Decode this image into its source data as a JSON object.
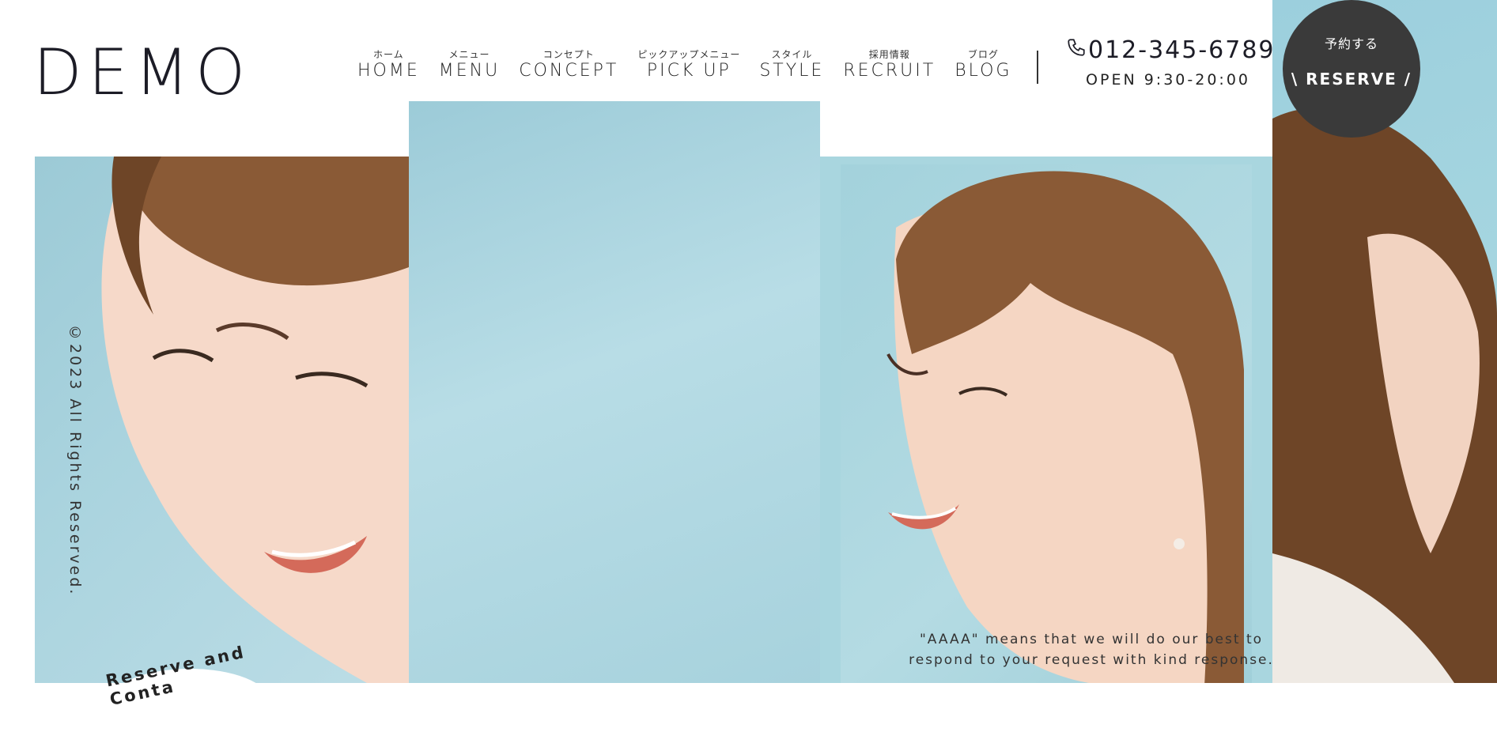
{
  "header": {
    "logo": "DEMO",
    "nav": [
      {
        "jp": "ホーム",
        "en": "HOME"
      },
      {
        "jp": "メニュー",
        "en": "MENU"
      },
      {
        "jp": "コンセプト",
        "en": "CONCEPT"
      },
      {
        "jp": "ピックアップメニュー",
        "en": "PICK UP"
      },
      {
        "jp": "スタイル",
        "en": "STYLE"
      },
      {
        "jp": "採用情報",
        "en": "RECRUIT"
      },
      {
        "jp": "ブログ",
        "en": "BLOG"
      }
    ],
    "phone": "012-345-6789",
    "hours": "OPEN 9:30-20:00"
  },
  "reserve": {
    "jp": "予約する",
    "en": "\\ RESERVE /"
  },
  "footer": {
    "copyright": "©2023 All Rights Reserved.",
    "contact_badge": "Reserve and Conta",
    "message_line1": "\"AAAA\" means that we will do our best to",
    "message_line2": "respond to your request with kind response."
  },
  "icons": {
    "phone": "phone-icon"
  },
  "colors": {
    "accent": "#3a3a3a",
    "sky": "#a9d6df"
  }
}
